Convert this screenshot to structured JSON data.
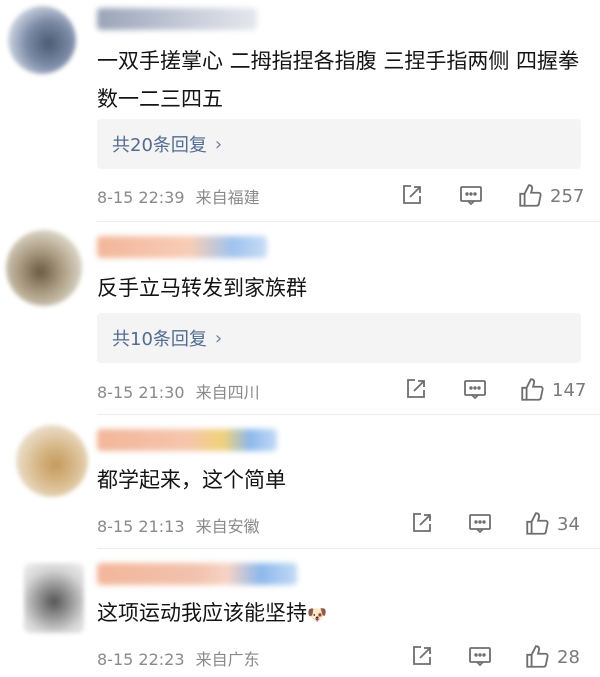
{
  "comments": [
    {
      "text": "一双手搓掌心 二拇指捏各指腹 三捏手指两侧 四握拳数一二三四五",
      "replies_label": "共20条回复",
      "time": "8-15 22:39",
      "location": "来自福建",
      "likes": "257"
    },
    {
      "text": "反手立马转发到家族群",
      "replies_label": "共10条回复",
      "time": "8-15 21:30",
      "location": "来自四川",
      "likes": "147"
    },
    {
      "text": "都学起来，这个简单",
      "time": "8-15 21:13",
      "location": "来自安徽",
      "likes": "34"
    },
    {
      "text": "这项运动我应该能坚持",
      "emoji": "🐶",
      "time": "8-15 22:23",
      "location": "来自广东",
      "likes": "28"
    }
  ],
  "icons": {
    "share": "share-icon",
    "comment": "comment-icon",
    "like": "thumbs-up-icon"
  },
  "colors": {
    "link": "#516b91",
    "meta": "#8a8a8a",
    "reply_bg": "#f4f4f4"
  }
}
